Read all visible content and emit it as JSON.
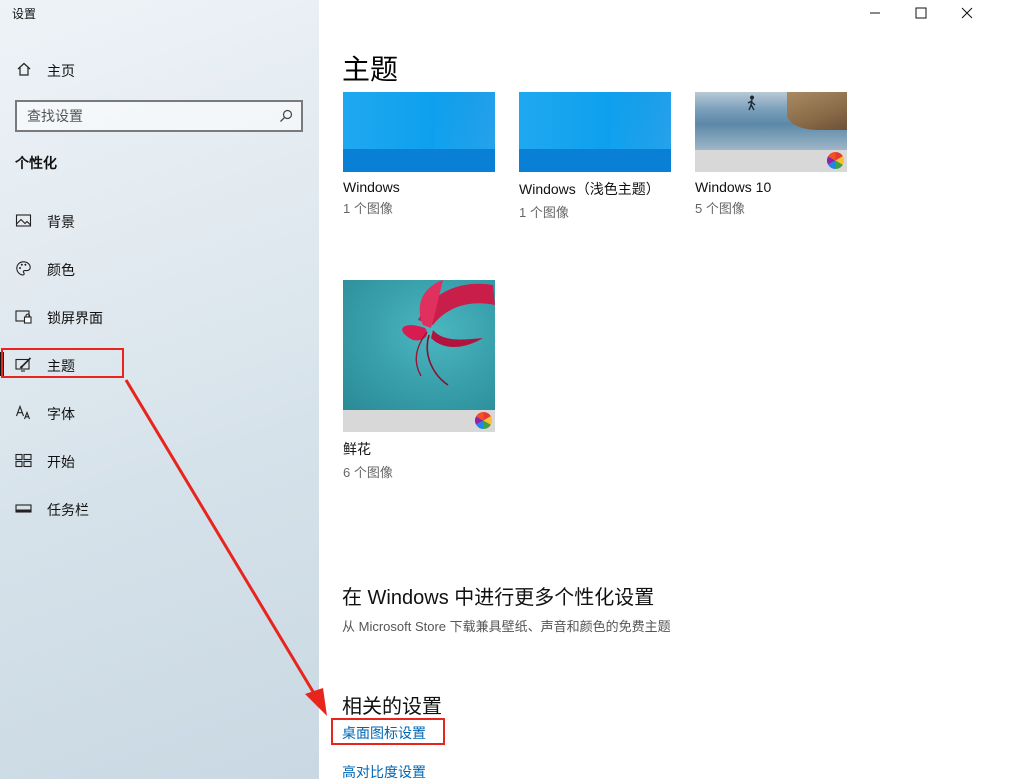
{
  "app_title": "设置",
  "window_controls": {
    "minimize": "minimize",
    "maximize": "maximize",
    "close": "close"
  },
  "sidebar": {
    "home_label": "主页",
    "search_placeholder": "查找设置",
    "section_title": "个性化",
    "items": [
      {
        "label": "背景",
        "icon": "image-icon"
      },
      {
        "label": "颜色",
        "icon": "palette-icon"
      },
      {
        "label": "锁屏界面",
        "icon": "lock-screen-icon"
      },
      {
        "label": "主题",
        "icon": "brush-icon",
        "active": true
      },
      {
        "label": "字体",
        "icon": "font-icon"
      },
      {
        "label": "开始",
        "icon": "start-icon"
      },
      {
        "label": "任务栏",
        "icon": "taskbar-icon"
      }
    ]
  },
  "main": {
    "title": "主题",
    "themes": [
      {
        "name": "Windows",
        "count": "1 个图像"
      },
      {
        "name": "Windows（浅色主题）",
        "count": "1 个图像"
      },
      {
        "name": "Windows 10",
        "count": "5 个图像"
      },
      {
        "name": "鲜花",
        "count": "6 个图像"
      }
    ],
    "more_title": "在 Windows 中进行更多个性化设置",
    "more_desc": "从 Microsoft Store 下载兼具壁纸、声音和颜色的免费主题",
    "related_title": "相关的设置",
    "related_links": [
      "桌面图标设置",
      "高对比度设置"
    ]
  },
  "annotation_color": "#e8241c",
  "accent_color": "#0066b4"
}
